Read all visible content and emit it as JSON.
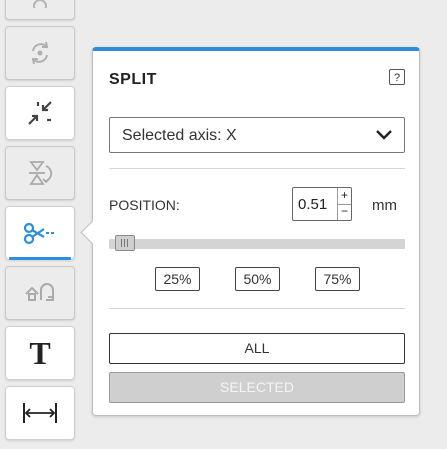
{
  "toolbar": {
    "tools": [
      {
        "name": "tool-top-partial",
        "icon": "settings-icon",
        "state": "disabled"
      },
      {
        "name": "rotate",
        "icon": "rotate-icon",
        "state": "disabled"
      },
      {
        "name": "scale",
        "icon": "scale-icon",
        "state": "enabled"
      },
      {
        "name": "place-face",
        "icon": "place-on-face-icon",
        "state": "disabled"
      },
      {
        "name": "split",
        "icon": "scissors-icon",
        "state": "active"
      },
      {
        "name": "support",
        "icon": "support-icon",
        "state": "disabled"
      },
      {
        "name": "text",
        "icon": "text-icon",
        "label": "T",
        "state": "enabled"
      },
      {
        "name": "measure",
        "icon": "measure-icon",
        "state": "enabled"
      }
    ]
  },
  "panel": {
    "title": "SPLIT",
    "help_label": "?",
    "axis_select": {
      "selected": "Selected axis: X"
    },
    "position": {
      "label": "POSITION:",
      "value": "0.51",
      "unit": "mm",
      "increment": "+",
      "decrement": "−",
      "slider_fraction": 0.02
    },
    "presets": [
      "25%",
      "50%",
      "75%"
    ],
    "buttons": {
      "all": "ALL",
      "selected": "SELECTED"
    }
  },
  "colors": {
    "accent": "#2a8fdd",
    "disabled_button": "#cfcfcf"
  }
}
